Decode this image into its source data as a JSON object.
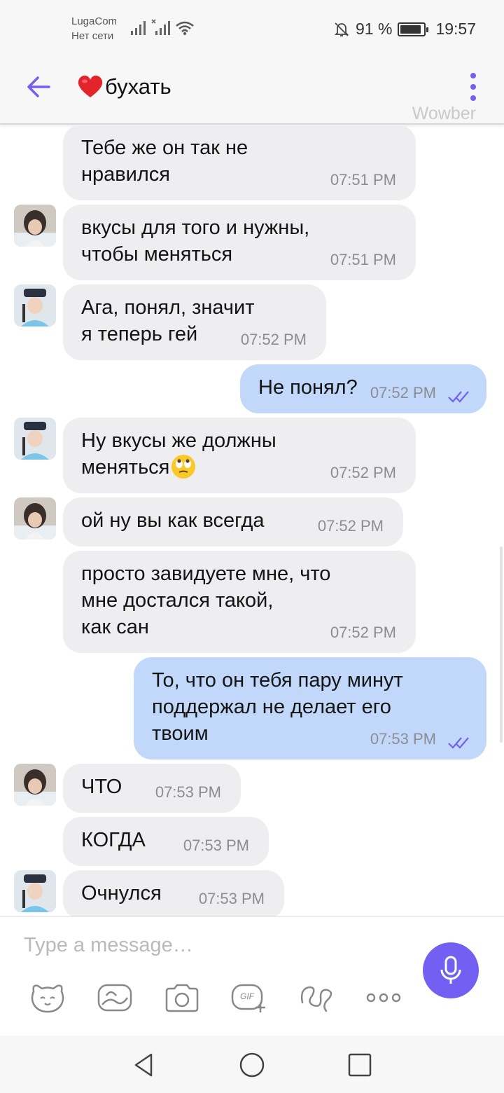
{
  "status_bar": {
    "carrier": "LugaCom",
    "network": "Нет сети",
    "battery": "91 %",
    "battery_level": 0.91,
    "time": "19:57"
  },
  "header": {
    "title": "бухать",
    "title_icon": "red-heart-emoji",
    "watermark": "Wowber"
  },
  "messages": [
    {
      "dir": "in",
      "avatar": null,
      "text": "Тебе же он так не\nнравился",
      "time": "07:51 PM"
    },
    {
      "dir": "in",
      "avatar": "avatar-1",
      "text": "вкусы для того и нужны,\nчтобы меняться",
      "time": "07:51 PM"
    },
    {
      "dir": "in",
      "avatar": "avatar-2",
      "text": "Ага, понял, значит\nя теперь гей",
      "time": "07:52 PM"
    },
    {
      "dir": "out",
      "text": "Не понял?",
      "time": "07:52 PM",
      "read": true
    },
    {
      "dir": "in",
      "avatar": "avatar-2",
      "text": "Ну вкусы же должны\nменяться",
      "emoji": "face-with-rolling-eyes",
      "time": "07:52 PM"
    },
    {
      "dir": "in",
      "avatar": "avatar-1",
      "text": "ой ну вы как всегда",
      "time": "07:52 PM"
    },
    {
      "dir": "in",
      "avatar": null,
      "text": "просто завидуете мне, что\nмне достался такой,\nкак сан",
      "time": "07:52 PM"
    },
    {
      "dir": "out",
      "text": "То, что он тебя пару минут\nподдержал не делает его\nтвоим",
      "time": "07:53 PM",
      "read": true
    },
    {
      "dir": "in",
      "avatar": "avatar-1",
      "text": "ЧТО",
      "time": "07:53 PM"
    },
    {
      "dir": "in",
      "avatar": null,
      "text": "КОГДА",
      "time": "07:53 PM"
    },
    {
      "dir": "in",
      "avatar": "avatar-2",
      "text": "Очнулся",
      "time": "07:53 PM"
    }
  ],
  "composer": {
    "placeholder": "Type a message…",
    "tools": [
      "sticker-icon",
      "gallery-icon",
      "camera-icon",
      "gif-icon",
      "doodle-icon",
      "more-icon"
    ],
    "gif_label": "GIF"
  },
  "colors": {
    "accent": "#7360f2",
    "incoming_bubble": "#eeedf0",
    "outgoing_bubble": "#c1d8fa"
  }
}
